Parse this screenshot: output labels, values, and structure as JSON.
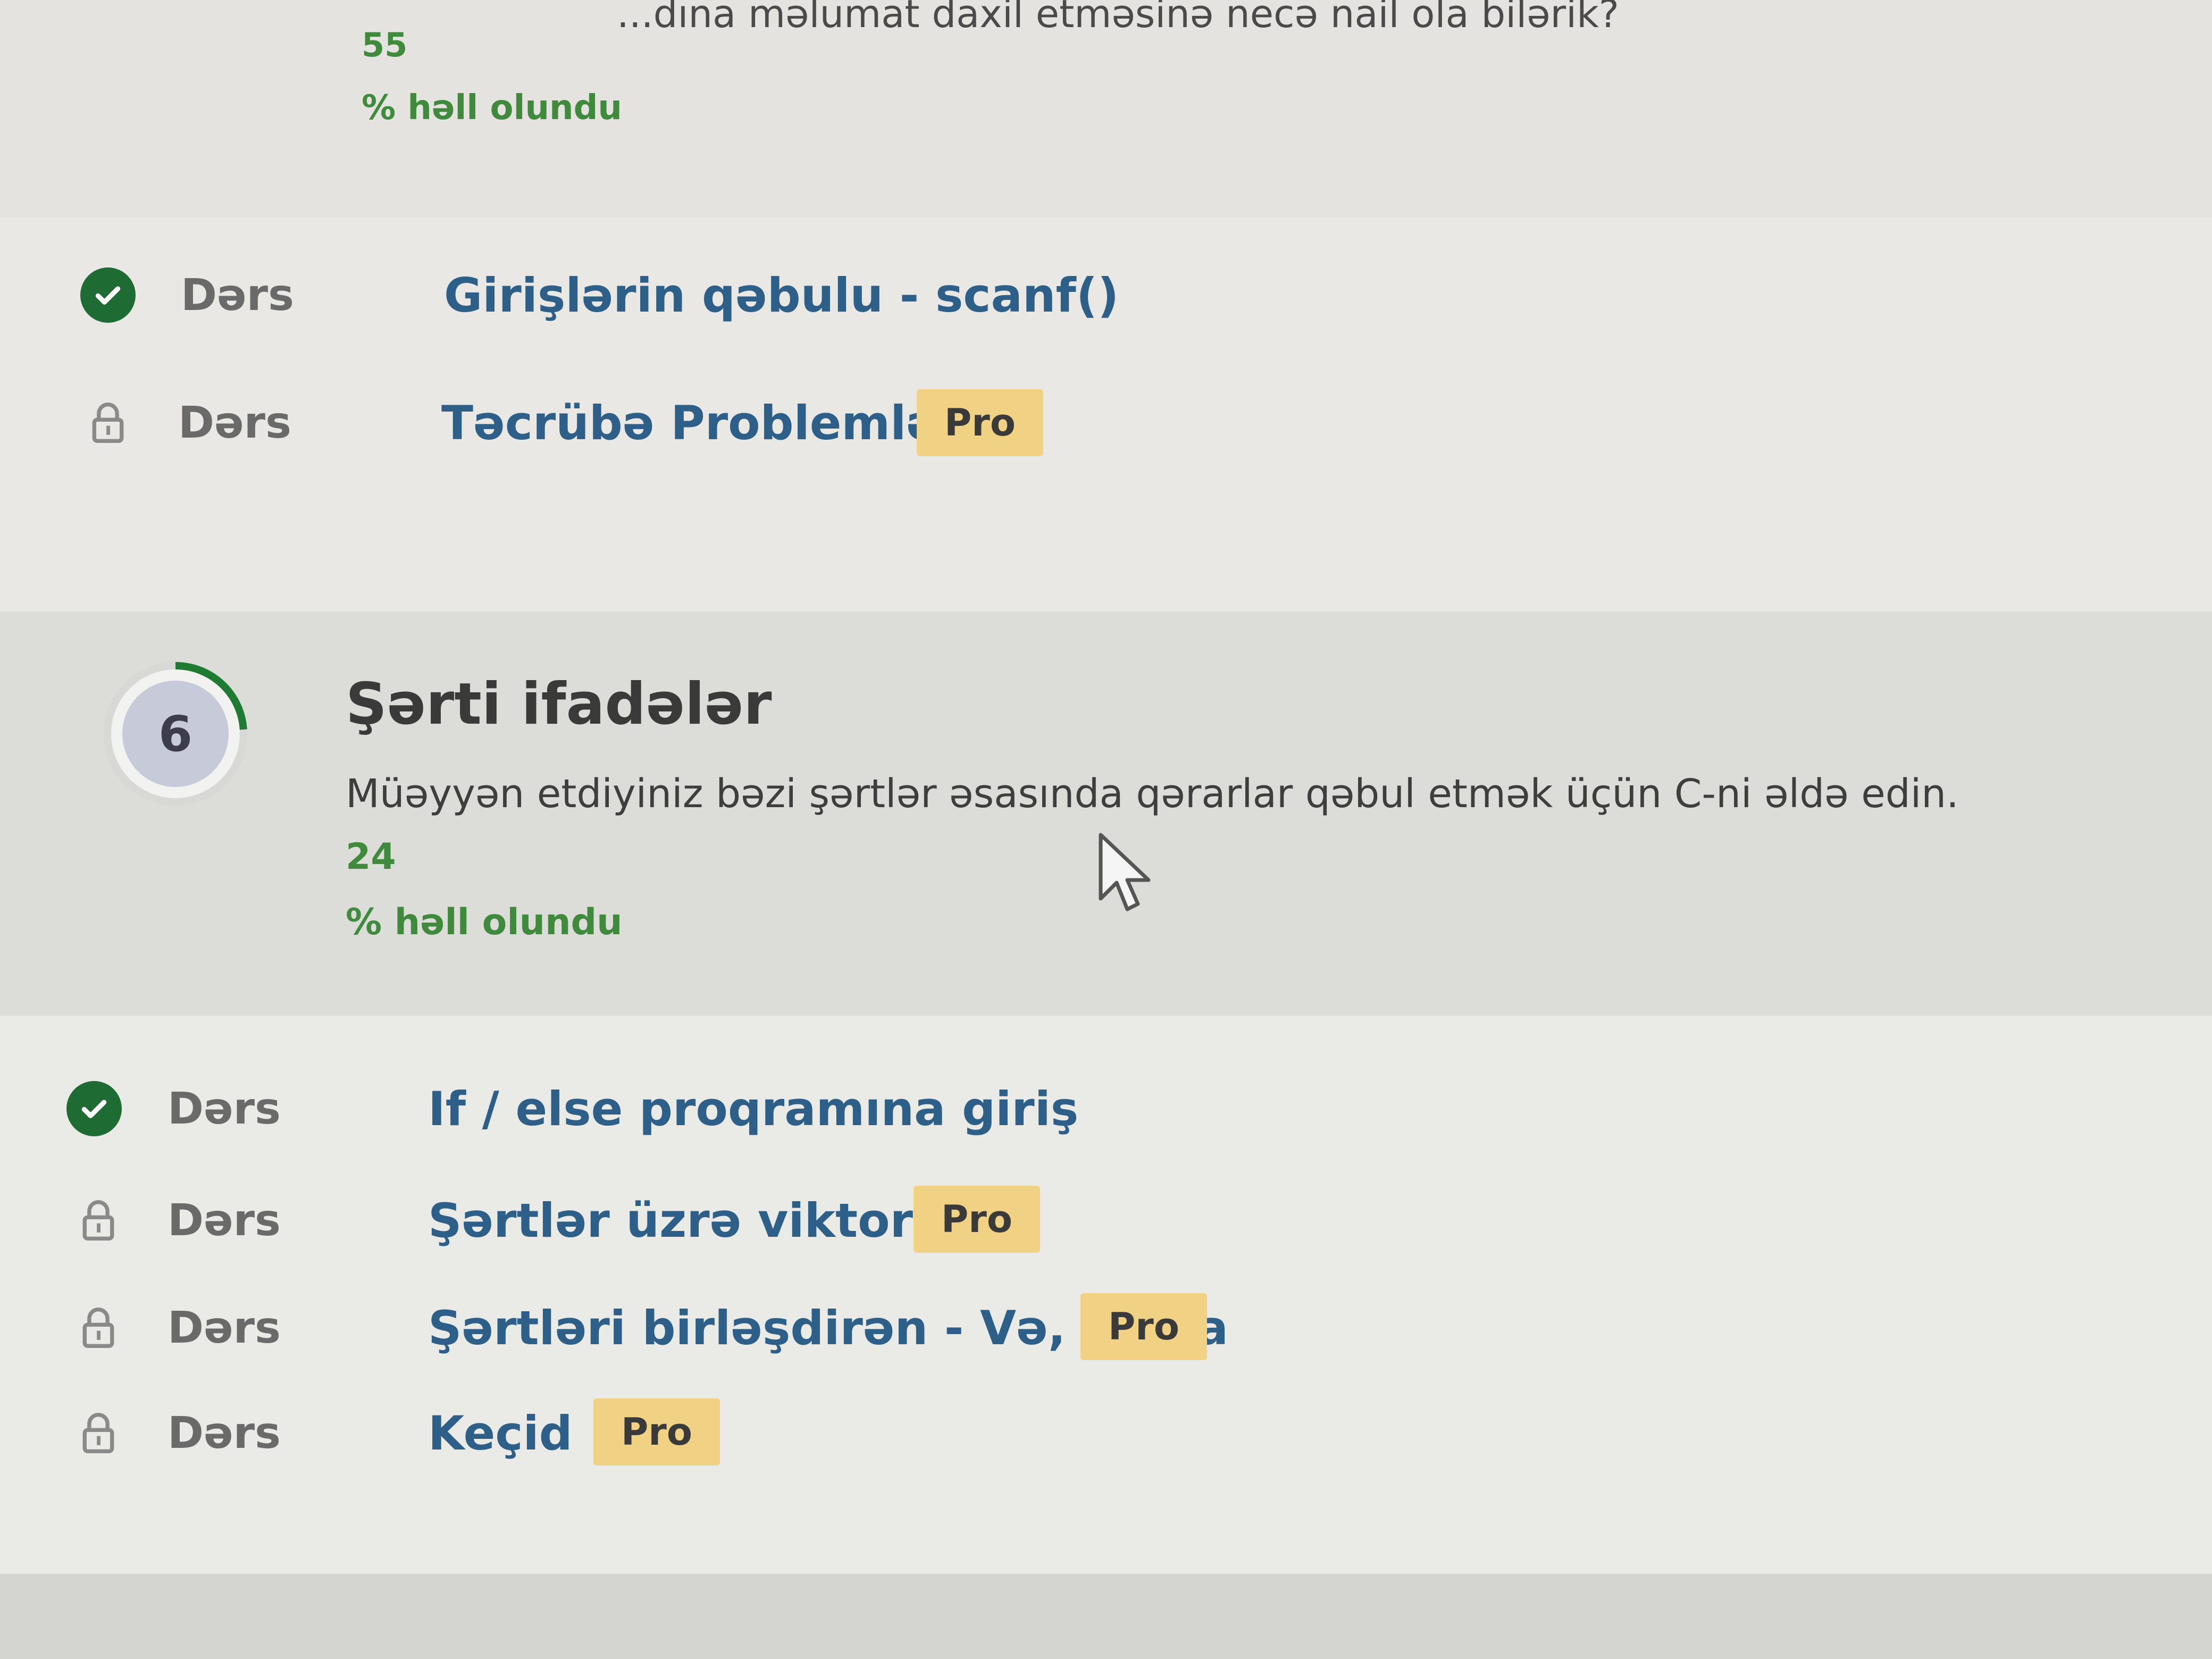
{
  "previous_chapter": {
    "title_partial": "...dına məlumat daxil etməsinə necə nail ola bilərik?",
    "solved_percent": "55",
    "solved_label": "% həll olundu"
  },
  "lessons_group_1": [
    {
      "type": "Dərs",
      "title": "Girişlərin qəbulu - scanf()",
      "status": "completed",
      "pro": ""
    },
    {
      "type": "Dərs",
      "title": "Təcrübə Problemləri",
      "status": "locked",
      "pro": "Pro"
    }
  ],
  "chapter": {
    "number": "6",
    "title": "Şərti ifadələr",
    "description": "Müəyyən etdiyiniz bəzi şərtlər əsasında qərarlar qəbul etmək üçün C-ni əldə edin.",
    "solved_percent": "24",
    "solved_label": "% həll olundu",
    "progress_fraction": 0.24,
    "progress_color": "#1f7a32"
  },
  "lessons_group_2": [
    {
      "type": "Dərs",
      "title": "If / else proqramına giriş",
      "status": "completed",
      "pro": ""
    },
    {
      "type": "Dərs",
      "title": "Şərtlər üzrə viktorina",
      "status": "locked",
      "pro": "Pro"
    },
    {
      "type": "Dərs",
      "title": "Şərtləri birləşdirən - Və, Və ya",
      "status": "locked",
      "pro": "Pro"
    },
    {
      "type": "Dərs",
      "title": "Keçid",
      "status": "locked",
      "pro": "Pro"
    }
  ],
  "icons": {
    "completed": "check-circle-icon",
    "locked": "lock-icon",
    "pointer": "mouse-cursor-icon"
  },
  "colors": {
    "link": "#2e5f88",
    "solved_text": "#3f8a3c",
    "pro_badge": "#f1d285",
    "check": "#1f6b34"
  }
}
